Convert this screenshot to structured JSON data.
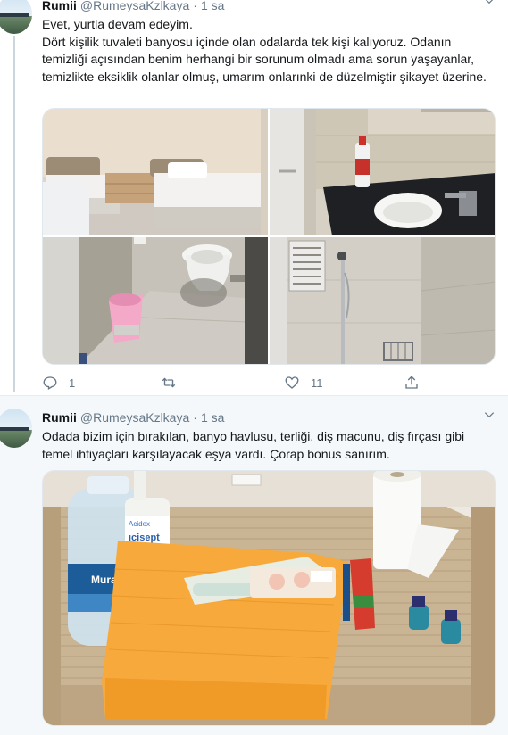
{
  "tweets": [
    {
      "name": "Rumii",
      "handle": "@RumeysaKzlkaya",
      "separator": "·",
      "time": "1 sa",
      "text_lines": [
        "Evet, yurtla devam edeyim.",
        "Dört kişilik tuvaleti banyosu içinde olan odalarda tek kişi kalıyoruz. Odanın temizliği açısından benim herhangi bir sorunum olmadı ama sorun yaşayanlar, temizlikte eksiklik olanlar olmuş, umarım onlarınki de düzelmiştir şikayet üzerine."
      ],
      "media": [
        "Dorm room with two beds",
        "Bathroom sink with bleach",
        "Toilet and bin",
        "Shower area"
      ],
      "actions": {
        "reply_count": "1",
        "retweet_count": "",
        "like_count": "11"
      }
    },
    {
      "name": "Rumii",
      "handle": "@RumeysaKzlkaya",
      "separator": "·",
      "time": "1 sa",
      "text_lines": [
        "Odada bizim için bırakılan, banyo havlusu, terliği, diş macunu, diş fırçası gibi temel ihtiyaçları karşılayacak eşya vardı. Çorap bonus sanırım."
      ],
      "media_labels": {
        "bottle_brand": "Muratsu",
        "sanitizer_label": "Acidex",
        "sanitizer_sub": "ıcisept"
      }
    }
  ],
  "colors": {
    "text": "#14171a",
    "secondary": "#657786",
    "towel": "#f7a93b",
    "background_alt": "#f5f8fa"
  },
  "icons": [
    "reply-icon",
    "retweet-icon",
    "like-icon",
    "share-icon",
    "caret-down-icon"
  ]
}
